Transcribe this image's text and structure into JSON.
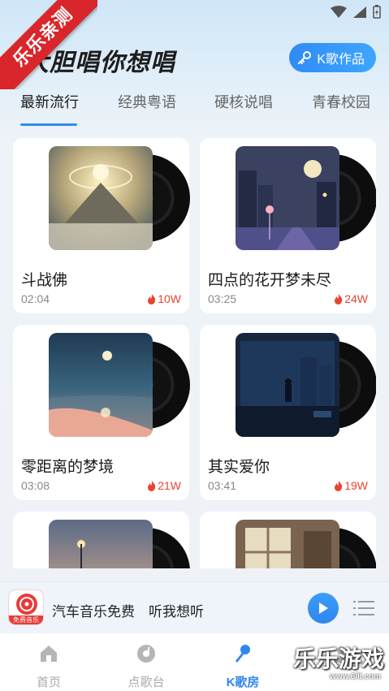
{
  "status_bar": {
    "icons": [
      "wifi-icon",
      "signal-icon",
      "battery-icon"
    ]
  },
  "ribbon": {
    "text": "乐乐亲测"
  },
  "header": {
    "title": "大胆唱你想唱",
    "k_works_button": "K歌作品"
  },
  "tabs": [
    {
      "label": "最新流行",
      "active": true
    },
    {
      "label": "经典粤语",
      "active": false
    },
    {
      "label": "硬核说唱",
      "active": false
    },
    {
      "label": "青春校园",
      "active": false
    }
  ],
  "songs": [
    {
      "title": "斗战佛",
      "duration": "02:04",
      "plays": "10W"
    },
    {
      "title": "四点的花开梦未尽",
      "duration": "03:25",
      "plays": "24W"
    },
    {
      "title": "零距离的梦境",
      "duration": "03:08",
      "plays": "21W"
    },
    {
      "title": "其实爱你",
      "duration": "03:41",
      "plays": "19W"
    },
    {
      "title": "",
      "duration": "",
      "plays": ""
    },
    {
      "title": "",
      "duration": "",
      "plays": ""
    }
  ],
  "player": {
    "logo_label": "免费音乐",
    "title": "汽车音乐免费　听我想听"
  },
  "bottom_nav": [
    {
      "label": "首页",
      "icon": "home-icon",
      "active": false
    },
    {
      "label": "点歌台",
      "icon": "disc-icon",
      "active": false
    },
    {
      "label": "K歌房",
      "icon": "microphone-icon",
      "active": true
    },
    {
      "label": "",
      "icon": "profile-icon",
      "active": false
    }
  ],
  "watermark": {
    "text": "乐乐游戏",
    "url": "www.6lll.com"
  },
  "colors": {
    "accent": "#2f86ee",
    "hot": "#e8452e",
    "ribbon": "#d8262b"
  }
}
